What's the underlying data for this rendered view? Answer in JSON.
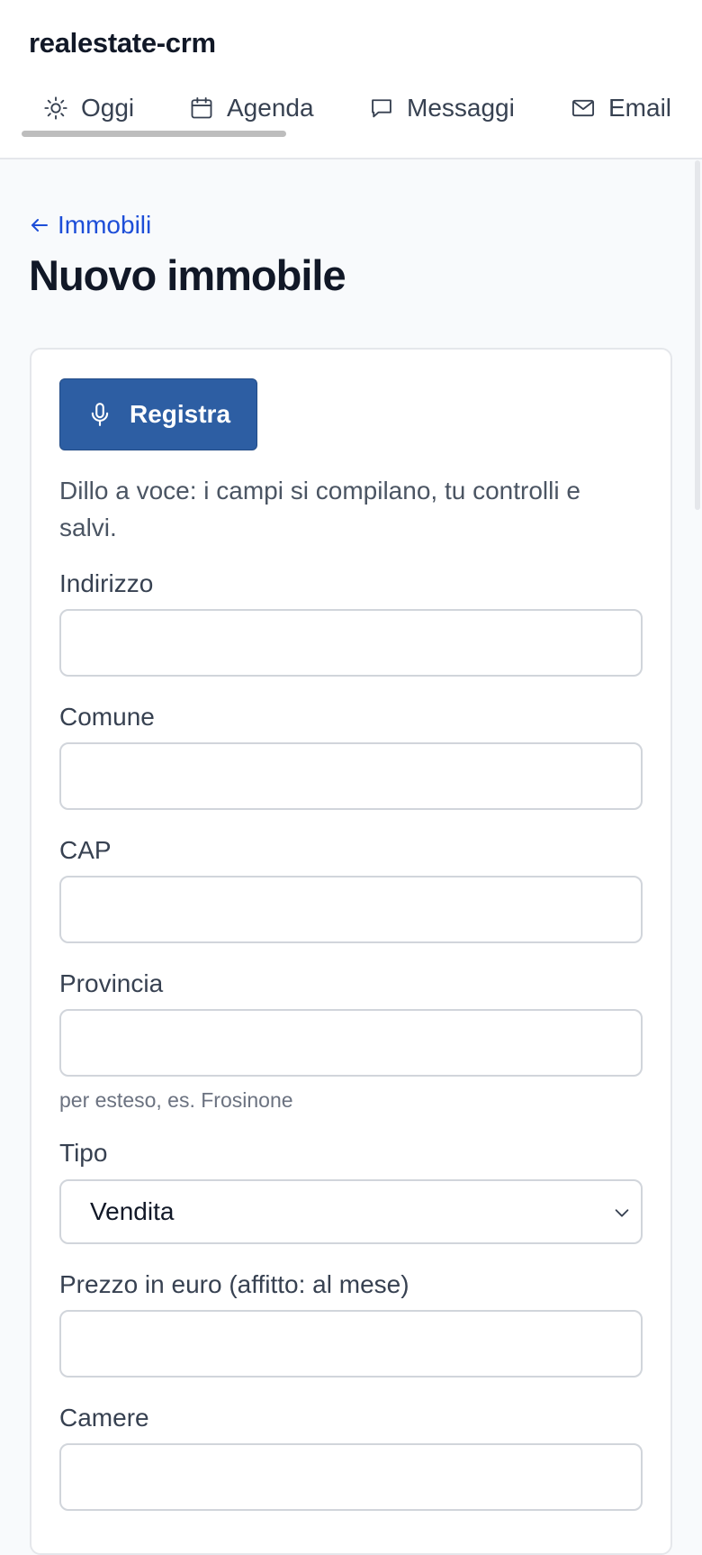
{
  "app": {
    "title": "realestate-crm"
  },
  "nav": {
    "tabs": [
      {
        "label": "Oggi",
        "icon": "sun-icon"
      },
      {
        "label": "Agenda",
        "icon": "calendar-icon"
      },
      {
        "label": "Messaggi",
        "icon": "chat-bubble-icon"
      },
      {
        "label": "Email",
        "icon": "envelope-icon"
      }
    ]
  },
  "breadcrumb": {
    "back_label": "Immobili"
  },
  "page": {
    "title": "Nuovo immobile"
  },
  "form": {
    "record_label": "Registra",
    "help_text": "Dillo a voce: i campi si compilano, tu controlli e salvi.",
    "fields": {
      "indirizzo": {
        "label": "Indirizzo",
        "value": ""
      },
      "comune": {
        "label": "Comune",
        "value": ""
      },
      "cap": {
        "label": "CAP",
        "value": ""
      },
      "provincia": {
        "label": "Provincia",
        "value": "",
        "hint": "per esteso, es. Frosinone"
      },
      "tipo": {
        "label": "Tipo",
        "selected": "Vendita"
      },
      "prezzo": {
        "label": "Prezzo in euro (affitto: al mese)",
        "value": ""
      },
      "camere": {
        "label": "Camere",
        "value": ""
      }
    }
  },
  "colors": {
    "primary_button": "#2d5ea3",
    "link": "#1d4ed8",
    "page_background": "#f8fafc"
  }
}
